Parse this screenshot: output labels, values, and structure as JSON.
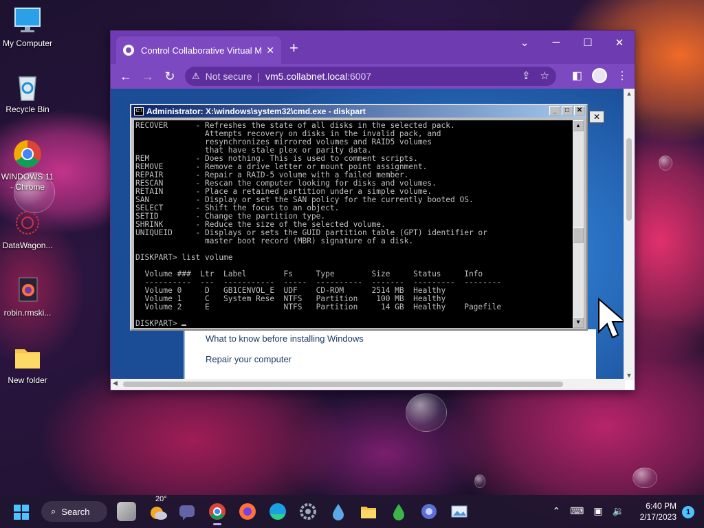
{
  "desktop": {
    "icons": [
      {
        "label": "My Computer"
      },
      {
        "label": "Recycle Bin"
      },
      {
        "label": "WINDOWS 11 - Chrome"
      },
      {
        "label": "DataWagon..."
      },
      {
        "label": "robin.rmski..."
      },
      {
        "label": "New folder"
      }
    ]
  },
  "browser": {
    "tab_title": "Control Collaborative Virtual Ma",
    "tab_close": "✕",
    "new_tab": "+",
    "window_controls": {
      "minimize": "─",
      "maximize": "☐",
      "close": "✕",
      "tabs_menu": "⌄"
    },
    "nav": {
      "back": "←",
      "forward": "→",
      "reload": "↻"
    },
    "address": {
      "security_label": "Not secure",
      "host": "vm5.collabnet.local",
      "port": ":6007"
    },
    "accent": "#6f3bb1"
  },
  "cmd": {
    "title": "Administrator: X:\\windows\\system32\\cmd.exe - diskpart",
    "icon_text": "C:\\",
    "console_lines": [
      "RECOVER      - Refreshes the state of all disks in the selected pack.",
      "               Attempts recovery on disks in the invalid pack, and",
      "               resynchronizes mirrored volumes and RAID5 volumes",
      "               that have stale plex or parity data.",
      "REM          - Does nothing. This is used to comment scripts.",
      "REMOVE       - Remove a drive letter or mount point assignment.",
      "REPAIR       - Repair a RAID-5 volume with a failed member.",
      "RESCAN       - Rescan the computer looking for disks and volumes.",
      "RETAIN       - Place a retained partition under a simple volume.",
      "SAN          - Display or set the SAN policy for the currently booted OS.",
      "SELECT       - Shift the focus to an object.",
      "SETID        - Change the partition type.",
      "SHRINK       - Reduce the size of the selected volume.",
      "UNIQUEID     - Displays or sets the GUID partition table (GPT) identifier or",
      "               master boot record (MBR) signature of a disk.",
      "",
      "DISKPART> list volume",
      "",
      "  Volume ###  Ltr  Label        Fs     Type        Size     Status     Info",
      "  ----------  ---  -----------  -----  ----------  -------  ---------  --------",
      "  Volume 0     D   GB1CENVOL_E  UDF    CD-ROM      2514 MB  Healthy",
      "  Volume 1     C   System Rese  NTFS   Partition    100 MB  Healthy",
      "  Volume 2     E                NTFS   Partition     14 GB  Healthy    Pagefile",
      ""
    ],
    "prompt": "DISKPART> "
  },
  "setup": {
    "link1": "What to know before installing Windows",
    "link2": "Repair your computer",
    "close_glyph": "✕"
  },
  "taskbar": {
    "search_label": "Search",
    "weather_temp": "20°",
    "time": "6:40 PM",
    "date": "2/17/2023",
    "notifications": "1",
    "apps": [
      "task-view",
      "weather",
      "teams-chat",
      "chrome",
      "firefox",
      "edge",
      "settings",
      "dropbox-drop",
      "file-explorer",
      "green-drop",
      "network-app",
      "photos-app"
    ]
  }
}
